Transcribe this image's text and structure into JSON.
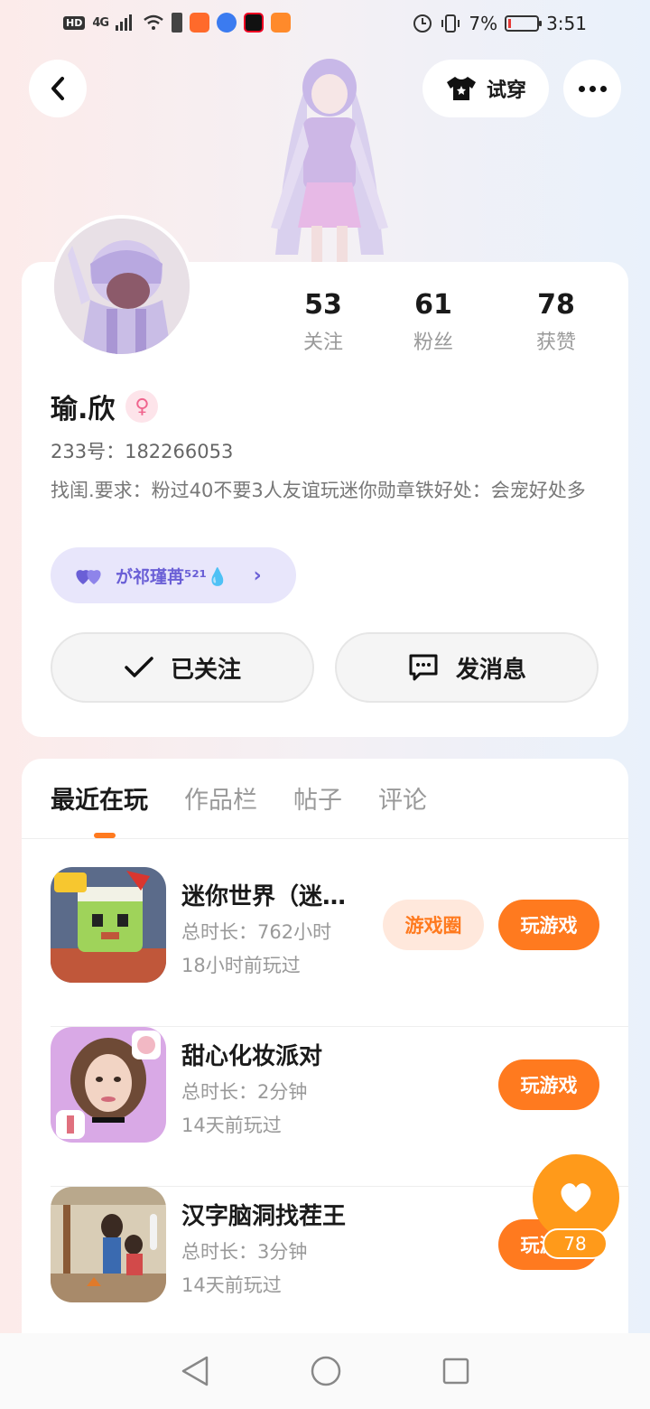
{
  "status_bar": {
    "hd": "HD",
    "network": "4G",
    "battery_percent": "7%",
    "time": "3:51"
  },
  "header": {
    "try_on_label": "试穿"
  },
  "profile": {
    "stats": [
      {
        "value": "53",
        "label": "关注"
      },
      {
        "value": "61",
        "label": "粉丝"
      },
      {
        "value": "78",
        "label": "获赞"
      }
    ],
    "name": "瑜.欣",
    "gender_symbol": "♀",
    "uid": "233号：182266053",
    "bio": "找闺.要求：粉过40不要3人友谊玩迷你勋章铁好处：会宠好处多",
    "badge": {
      "text": "が祁瑾苒⁵²¹💧"
    },
    "follow_button": "已关注",
    "message_button": "发消息"
  },
  "tabs": [
    {
      "label": "最近在玩"
    },
    {
      "label": "作品栏"
    },
    {
      "label": "帖子"
    },
    {
      "label": "评论"
    }
  ],
  "games": [
    {
      "title": "迷你世界（迷你世界）",
      "duration": "总时长：762小时",
      "last_played": "18小时前玩过",
      "circle_button": "游戏圈",
      "play_button": "玩游戏"
    },
    {
      "title": "甜心化妆派对",
      "duration": "总时长：2分钟",
      "last_played": "14天前玩过",
      "play_button": "玩游戏"
    },
    {
      "title": "汉字脑洞找茬王",
      "duration": "总时长：3分钟",
      "last_played": "14天前玩过",
      "play_button": "玩游戏"
    }
  ],
  "like_fab": {
    "count": "78"
  },
  "colors": {
    "accent": "#ff7a1f",
    "accent_light": "#ffe8dc",
    "badge_bg": "#e8e6fb",
    "badge_text": "#6a5fd6",
    "fab": "#ff9a1a"
  }
}
